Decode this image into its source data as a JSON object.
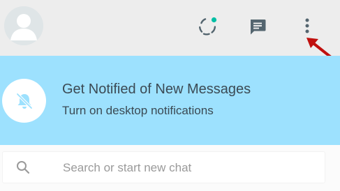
{
  "header": {
    "avatar_icon": "default-user-avatar",
    "actions": [
      "status-icon",
      "new-chat-icon",
      "menu-kebab-icon"
    ],
    "status_dot_color": "#00bfa5"
  },
  "notification_banner": {
    "title": "Get Notified of New Messages",
    "subtitle": "Turn on desktop notifications",
    "icon": "bell-off-icon",
    "background": "#9de1fe"
  },
  "search": {
    "placeholder": "Search or start new chat",
    "value": "",
    "icon": "search-icon"
  },
  "annotation": {
    "icon": "red-arrow-pointer",
    "color": "#c0100e"
  }
}
